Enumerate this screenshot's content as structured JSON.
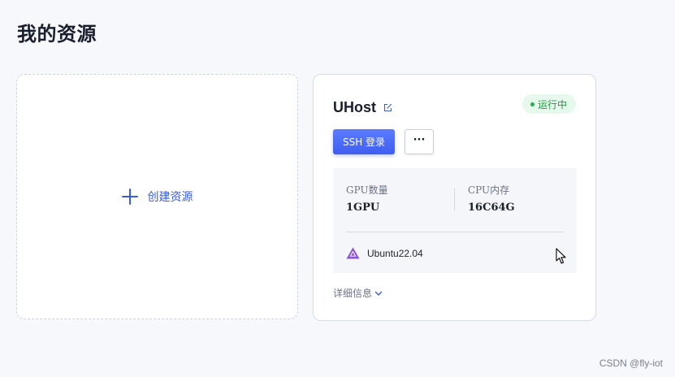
{
  "page": {
    "title": "我的资源"
  },
  "create_card": {
    "label": "创建资源",
    "icon": "plus-icon"
  },
  "host_card": {
    "name": "UHost",
    "status": "运行中",
    "ssh_button_label": "SSH 登录",
    "more_button_label": "···",
    "specs": {
      "gpu_label": "GPU数量",
      "gpu_value": "1GPU",
      "cpu_label": "CPU内存",
      "cpu_value": "16C64G"
    },
    "os": {
      "icon": "ubuntu-icon",
      "label": "Ubuntu22.04"
    },
    "details_label": "详细信息"
  },
  "watermark": "CSDN @fly-iot",
  "colors": {
    "accent": "#3a5bd9",
    "primary_button": "#4a6cf7",
    "status_bg": "#e7f9ec",
    "status_text": "#1f9a43",
    "os_icon": "#8a52d6"
  }
}
